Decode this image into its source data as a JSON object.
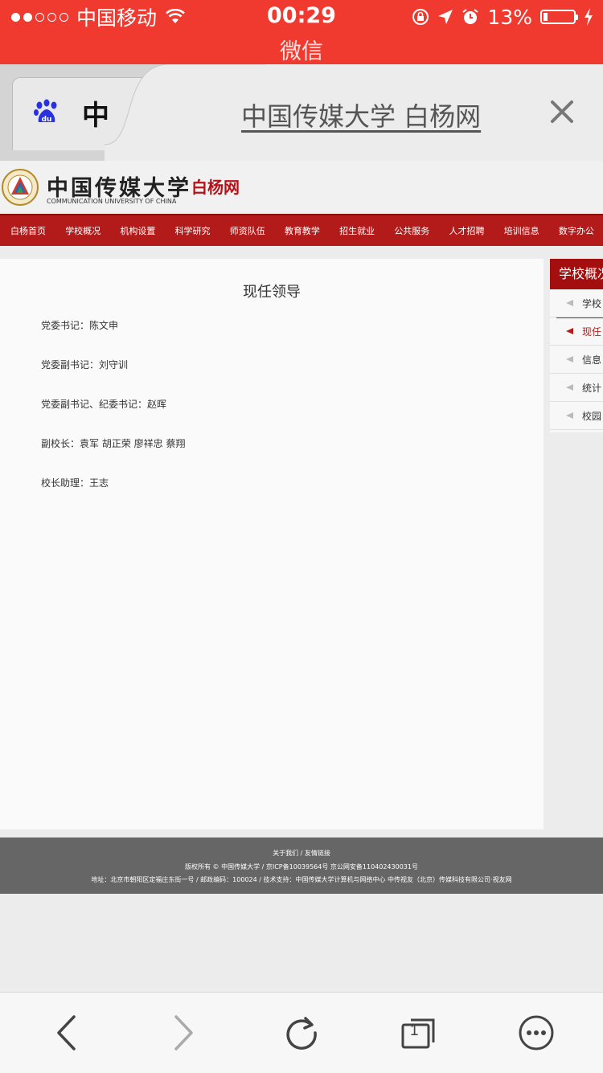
{
  "status_bar": {
    "carrier": "中国移动",
    "time": "00:29",
    "battery_percent": "13%",
    "battery_level": 0.13,
    "signal_bars": 2,
    "app_name": "微信",
    "bar_color": "#f03a30"
  },
  "title_bar": {
    "tab_glyph": "中",
    "page_title": "中国传媒大学 白杨网",
    "close_icon": "close-icon"
  },
  "site": {
    "name_cn": "中国传媒大学",
    "name_en": "COMMUNICATION UNIVERSITY OF CHINA",
    "subsite": "白杨网",
    "brand_color": "#b31b1b"
  },
  "nav": [
    "白杨首页",
    "学校概况",
    "机构设置",
    "科学研究",
    "师资队伍",
    "教育教学",
    "招生就业",
    "公共服务",
    "人才招聘",
    "培训信息",
    "数字办公"
  ],
  "main": {
    "title": "现任领导",
    "leaders": [
      "党委书记：陈文申",
      "党委副书记：刘守训",
      "党委副书记、纪委书记：赵晖",
      "副校长：袁军 胡正荣 廖祥忠 蔡翔",
      "校长助理：王志"
    ]
  },
  "sidebar": {
    "heading": "学校概况",
    "items": [
      "学校",
      "现任",
      "信息",
      "统计",
      "校园"
    ],
    "active_index": 1
  },
  "footer": {
    "links": "关于我们 / 友情链接",
    "copyright": "版权所有 © 中国传媒大学 / 京ICP备10039564号 京公网安备110402430031号",
    "address": "地址：北京市朝阳区定福庄东街一号 / 邮政编码：100024 / 技术支持：中国传媒大学计算机与网络中心 中传视友（北京）传媒科技有限公司·视友网"
  },
  "toolbar": {
    "tab_count": "1",
    "icons": [
      "back-icon",
      "forward-icon",
      "refresh-icon",
      "tabs-icon",
      "more-icon"
    ]
  }
}
